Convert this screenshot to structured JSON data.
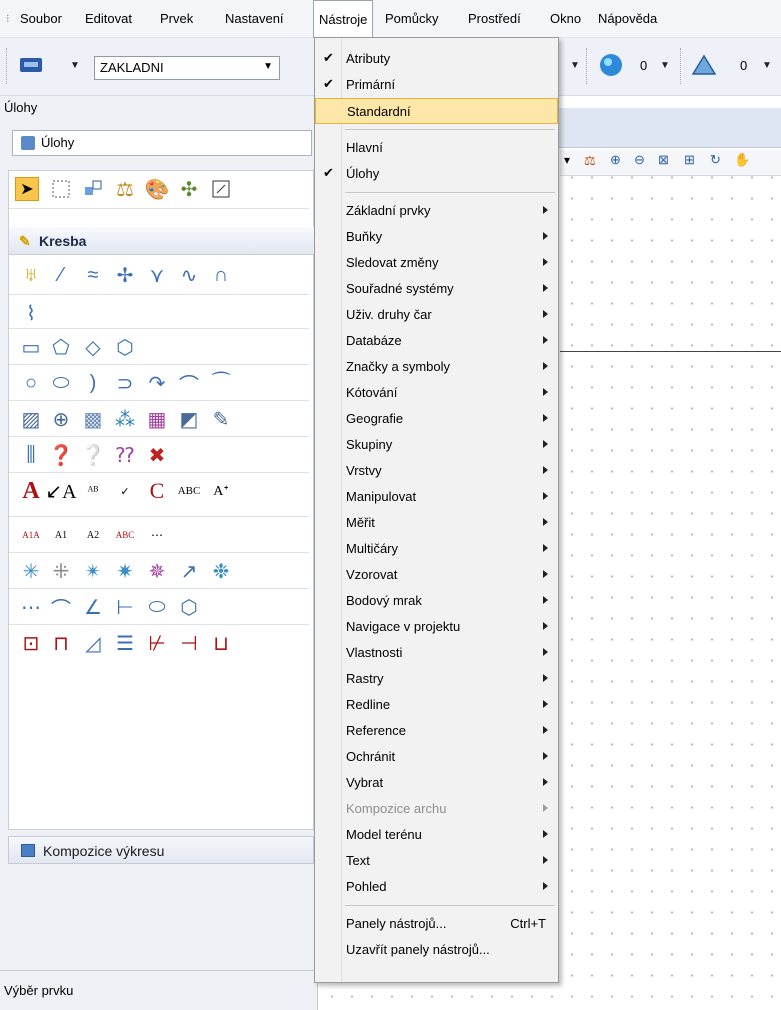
{
  "menubar": {
    "items": [
      "Soubor",
      "Editovat",
      "Prvek",
      "Nastavení",
      "Nástroje",
      "Pomůcky",
      "Prostředí",
      "Okno",
      "Nápověda"
    ]
  },
  "toolbar": {
    "level_combo": "ZAKLADNI",
    "color_value": "0",
    "weight_value": "0"
  },
  "left_panel": {
    "title": "Úlohy",
    "tasks_combo": "Úlohy",
    "section_kresba": "Kresba",
    "kompozice": "Kompozice výkresu",
    "bottom_label": "Výběr prvku"
  },
  "menu": {
    "checked_items": [
      {
        "label": "Atributy",
        "checked": true
      },
      {
        "label": "Primární",
        "checked": true
      },
      {
        "label": "Standardní",
        "checked": false,
        "highlighted": true
      }
    ],
    "view_items": [
      {
        "label": "Hlavní",
        "checked": false
      },
      {
        "label": "Úlohy",
        "checked": true
      }
    ],
    "submenu_items": [
      {
        "label": "Základní prvky",
        "disabled": false
      },
      {
        "label": "Buňky",
        "disabled": false
      },
      {
        "label": "Sledovat změny",
        "disabled": false
      },
      {
        "label": "Souřadné systémy",
        "disabled": false
      },
      {
        "label": "Uživ. druhy čar",
        "disabled": false
      },
      {
        "label": "Databáze",
        "disabled": false
      },
      {
        "label": "Značky a symboly",
        "disabled": false
      },
      {
        "label": "Kótování",
        "disabled": false
      },
      {
        "label": "Geografie",
        "disabled": false
      },
      {
        "label": "Skupiny",
        "disabled": false
      },
      {
        "label": "Vrstvy",
        "disabled": false
      },
      {
        "label": "Manipulovat",
        "disabled": false
      },
      {
        "label": "Měřit",
        "disabled": false
      },
      {
        "label": "Multičáry",
        "disabled": false
      },
      {
        "label": "Vzorovat",
        "disabled": false
      },
      {
        "label": "Bodový mrak",
        "disabled": false
      },
      {
        "label": "Navigace v projektu",
        "disabled": false
      },
      {
        "label": "Vlastnosti",
        "disabled": false
      },
      {
        "label": "Rastry",
        "disabled": false
      },
      {
        "label": "Redline",
        "disabled": false
      },
      {
        "label": "Reference",
        "disabled": false
      },
      {
        "label": "Ochránit",
        "disabled": false
      },
      {
        "label": "Vybrat",
        "disabled": false
      },
      {
        "label": "Kompozice archu",
        "disabled": true
      },
      {
        "label": "Model terénu",
        "disabled": false
      },
      {
        "label": "Text",
        "disabled": false
      },
      {
        "label": "Pohled",
        "disabled": false
      }
    ],
    "bottom_items": [
      {
        "label": "Panely nástrojů...",
        "shortcut": "Ctrl+T"
      },
      {
        "label": "Uzavřít panely nástrojů...",
        "shortcut": ""
      }
    ]
  }
}
